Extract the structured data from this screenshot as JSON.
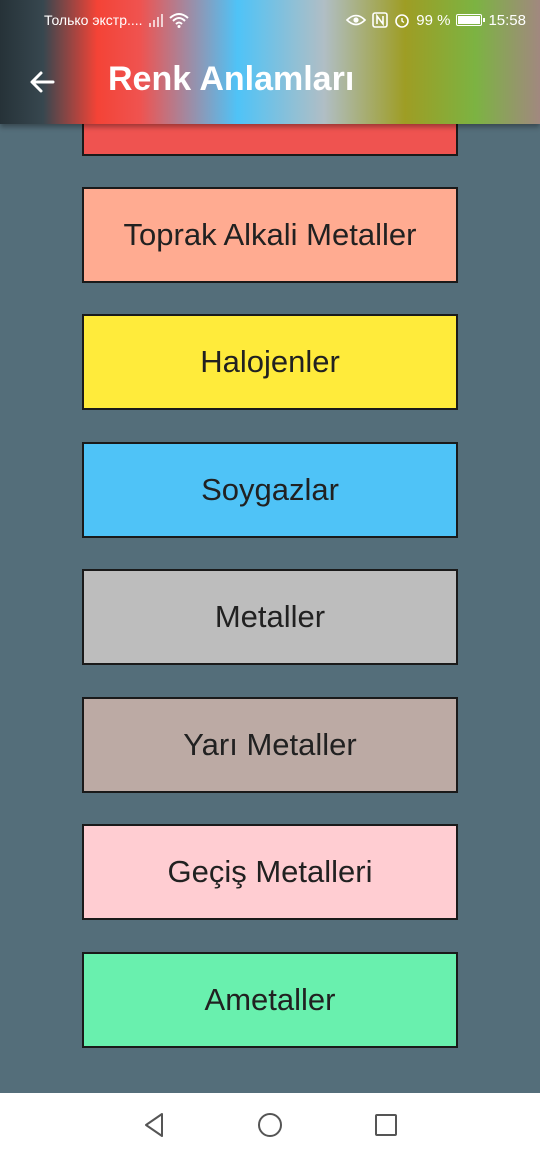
{
  "status_bar": {
    "carrier": "Только экстр....",
    "battery": "99 %",
    "time": "15:58",
    "icons": [
      "eye-icon",
      "nfc-icon",
      "alarm-icon",
      "battery-icon",
      "wifi-icon",
      "signal-icon"
    ]
  },
  "app_bar": {
    "title": "Renk Anlamları",
    "back_icon": "arrow-left-icon"
  },
  "items": [
    {
      "label": "",
      "color": "#ef5350"
    },
    {
      "label": "Toprak Alkali Metaller",
      "color": "#ffab91"
    },
    {
      "label": "Halojenler",
      "color": "#ffeb3b"
    },
    {
      "label": "Soygazlar",
      "color": "#4fc3f7"
    },
    {
      "label": "Metaller",
      "color": "#bdbdbd"
    },
    {
      "label": "Yarı Metaller",
      "color": "#bcaaa4"
    },
    {
      "label": "Geçiş Metalleri",
      "color": "#ffcdd2"
    },
    {
      "label": "Ametaller",
      "color": "#69f0ae"
    }
  ],
  "nav_bar": {
    "icons": [
      "back-triangle-icon",
      "home-circle-icon",
      "recents-square-icon"
    ]
  }
}
